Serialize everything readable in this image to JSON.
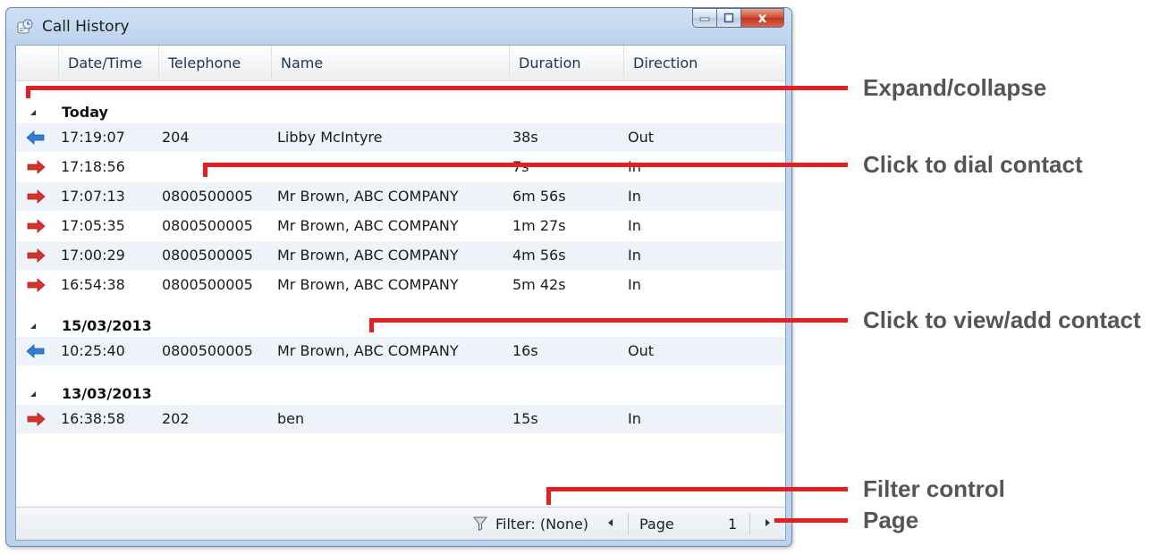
{
  "window": {
    "title": "Call History",
    "close_glyph": "x"
  },
  "columns": [
    "Date/Time",
    "Telephone",
    "Name",
    "Duration",
    "Direction"
  ],
  "groups": [
    {
      "label": "Today",
      "rows": [
        {
          "direction_icon": "outgoing-arrow-icon",
          "time": "17:19:07",
          "telephone": "204",
          "name": "Libby McIntyre",
          "duration": "38s",
          "direction": "Out"
        },
        {
          "direction_icon": "incoming-arrow-icon",
          "time": "17:18:56",
          "telephone": "",
          "name": "",
          "duration": "7s",
          "direction": "In"
        },
        {
          "direction_icon": "incoming-arrow-icon",
          "time": "17:07:13",
          "telephone": "0800500005",
          "name": "Mr Brown, ABC COMPANY",
          "duration": "6m 56s",
          "direction": "In"
        },
        {
          "direction_icon": "incoming-arrow-icon",
          "time": "17:05:35",
          "telephone": "0800500005",
          "name": "Mr Brown, ABC COMPANY",
          "duration": "1m 27s",
          "direction": "In"
        },
        {
          "direction_icon": "incoming-arrow-icon",
          "time": "17:00:29",
          "telephone": "0800500005",
          "name": "Mr Brown, ABC COMPANY",
          "duration": "4m 56s",
          "direction": "In"
        },
        {
          "direction_icon": "incoming-arrow-icon",
          "time": "16:54:38",
          "telephone": "0800500005",
          "name": "Mr Brown, ABC COMPANY",
          "duration": "5m 42s",
          "direction": "In"
        }
      ]
    },
    {
      "label": "15/03/2013",
      "rows": [
        {
          "direction_icon": "outgoing-arrow-icon",
          "time": "10:25:40",
          "telephone": "0800500005",
          "name": "Mr Brown, ABC COMPANY",
          "duration": "16s",
          "direction": "Out"
        }
      ]
    },
    {
      "label": "13/03/2013",
      "rows": [
        {
          "direction_icon": "incoming-arrow-icon",
          "time": "16:38:58",
          "telephone": "202",
          "name": "ben",
          "duration": "15s",
          "direction": "In"
        }
      ]
    }
  ],
  "statusbar": {
    "filter_label": "Filter: (None)",
    "page_label": "Page",
    "page_number": "1"
  },
  "callouts": {
    "expand_collapse": "Expand/collapse",
    "dial_contact": "Click to dial contact",
    "view_add_contact": "Click to view/add contact",
    "filter_control": "Filter control",
    "page": "Page"
  },
  "colors": {
    "callout_red": "#e31e24",
    "callout_text": "#555555",
    "incoming_arrow": "#d9322a",
    "outgoing_arrow": "#2f7fd6",
    "alt_row": "#eef3f9"
  }
}
